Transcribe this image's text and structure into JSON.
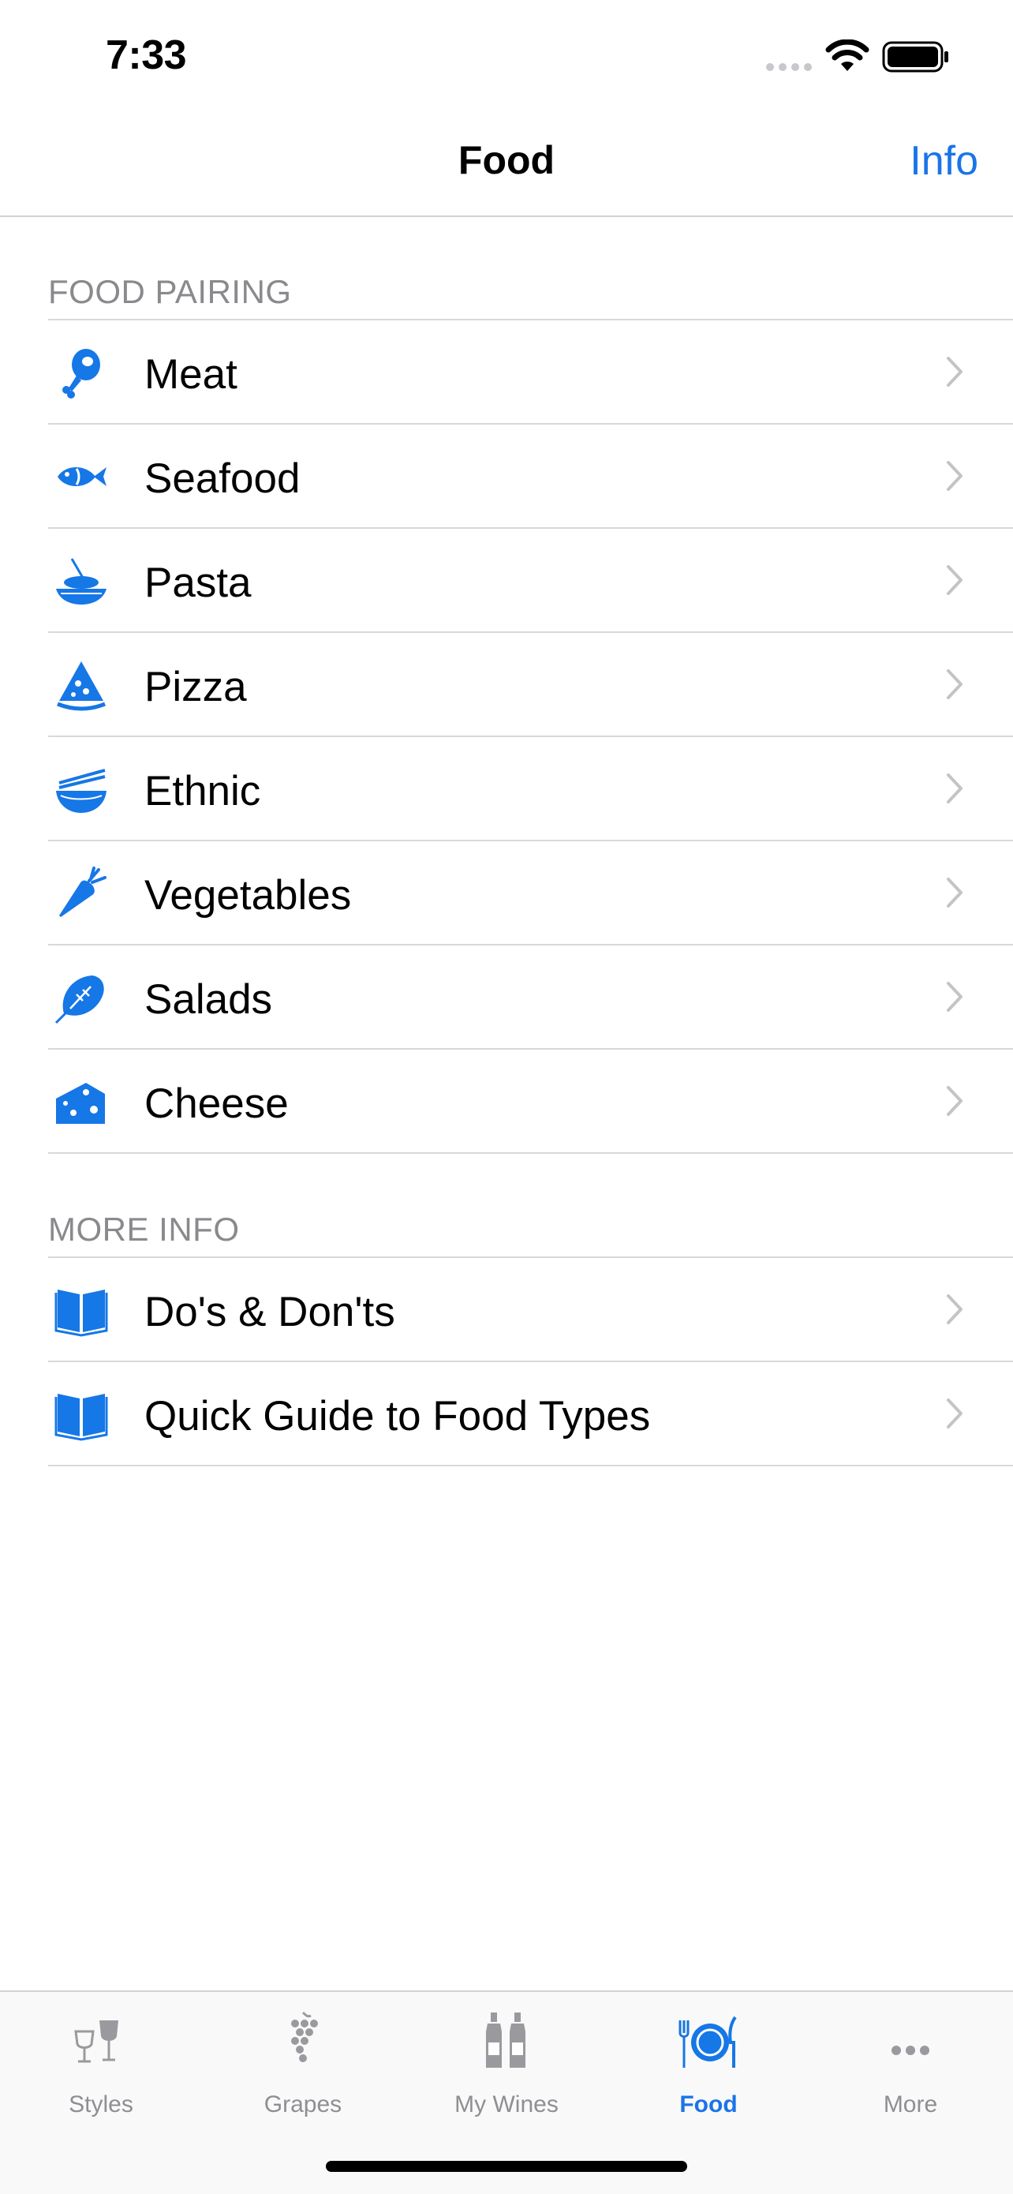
{
  "status_bar": {
    "time": "7:33"
  },
  "nav": {
    "title": "Food",
    "right_button": "Info"
  },
  "sections": {
    "food_pairing": {
      "header": "FOOD PAIRING",
      "items": [
        {
          "label": "Meat",
          "icon": "meat-icon"
        },
        {
          "label": "Seafood",
          "icon": "fish-icon"
        },
        {
          "label": "Pasta",
          "icon": "pasta-icon"
        },
        {
          "label": "Pizza",
          "icon": "pizza-icon"
        },
        {
          "label": "Ethnic",
          "icon": "bowl-chopsticks-icon"
        },
        {
          "label": "Vegetables",
          "icon": "carrot-icon"
        },
        {
          "label": "Salads",
          "icon": "lettuce-icon"
        },
        {
          "label": "Cheese",
          "icon": "cheese-icon"
        }
      ]
    },
    "more_info": {
      "header": "MORE INFO",
      "items": [
        {
          "label": "Do's & Don'ts",
          "icon": "book-icon"
        },
        {
          "label": "Quick Guide to Food Types",
          "icon": "book-icon"
        }
      ]
    }
  },
  "tab_bar": {
    "tabs": [
      {
        "label": "Styles",
        "icon": "wine-glasses-icon",
        "active": false
      },
      {
        "label": "Grapes",
        "icon": "grapes-icon",
        "active": false
      },
      {
        "label": "My Wines",
        "icon": "wine-bottles-icon",
        "active": false
      },
      {
        "label": "Food",
        "icon": "plate-fork-knife-icon",
        "active": true
      },
      {
        "label": "More",
        "icon": "more-dots-icon",
        "active": false
      }
    ]
  },
  "colors": {
    "accent": "#1a74e8",
    "inactive": "#8e8e93",
    "separator": "#d8d8dc",
    "icon_blue": "#1677e6"
  }
}
